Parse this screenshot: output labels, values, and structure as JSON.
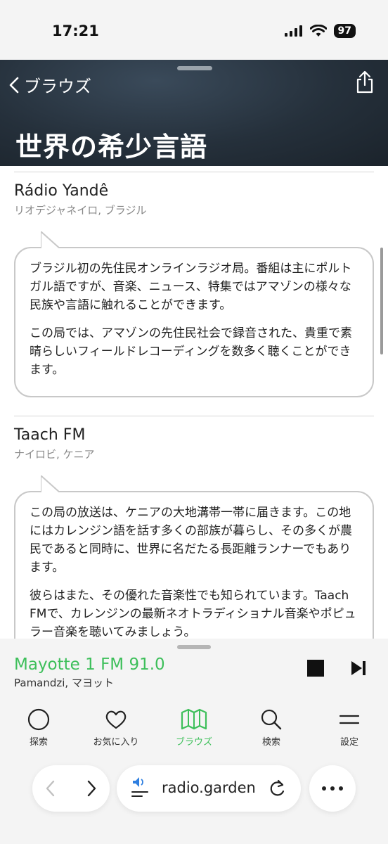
{
  "status": {
    "time": "17:21",
    "battery": "97"
  },
  "header": {
    "back_label": "ブラウズ",
    "title": "世界の希少言語"
  },
  "stations": [
    {
      "name": "Rádio Yandê",
      "location": "リオデジャネイロ, ブラジル",
      "paragraphs": [
        "ブラジル初の先住民オンラインラジオ局。番組は主にポルトガル語ですが、音楽、ニュース、特集ではアマゾンの様々な民族や言語に触れることができます。",
        "この局では、アマゾンの先住民社会で録音された、貴重で素晴らしいフィールドレコーディングを数多く聴くことができます。"
      ]
    },
    {
      "name": "Taach FM",
      "location": "ナイロビ, ケニア",
      "paragraphs": [
        "この局の放送は、ケニアの大地溝帯一帯に届きます。この地にはカレンジン語を話す多くの部族が暮らし、その多くが農民であると同時に、世界に名だたる長距離ランナーでもあります。",
        "彼らはまた、その優れた音楽性でも知られています。Taach FMで、カレンジンの最新ネオトラディショナル音楽やポピュラー音楽を聴いてみましょう。"
      ]
    }
  ],
  "player": {
    "title": "Mayotte 1 FM 91.0",
    "subtitle": "Pamandzi, マヨット"
  },
  "tabs": [
    {
      "label": "探索",
      "icon": "circle-icon"
    },
    {
      "label": "お気に入り",
      "icon": "heart-icon"
    },
    {
      "label": "ブラウズ",
      "icon": "map-icon",
      "active": true
    },
    {
      "label": "検索",
      "icon": "search-icon"
    },
    {
      "label": "設定",
      "icon": "menu-icon"
    }
  ],
  "browser": {
    "url": "radio.garden"
  },
  "colors": {
    "accent": "#3dbf5a",
    "header_bg": "#25303b"
  }
}
